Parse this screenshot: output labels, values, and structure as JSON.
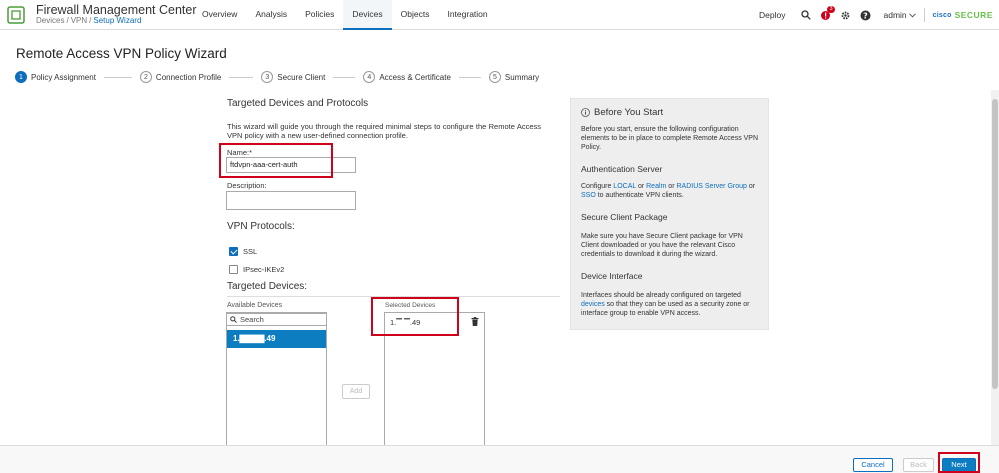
{
  "header": {
    "app_title": "Firewall Management Center",
    "breadcrumb": [
      "Devices",
      "VPN",
      "Setup Wizard"
    ],
    "nav_items": [
      {
        "label": "Overview"
      },
      {
        "label": "Analysis"
      },
      {
        "label": "Policies"
      },
      {
        "label": "Devices",
        "active": true
      },
      {
        "label": "Objects"
      },
      {
        "label": "Integration"
      }
    ],
    "deploy_label": "Deploy",
    "notification_count": "3",
    "user_label": "admin",
    "cisco_label": "cisco",
    "secure_label": "SECURE"
  },
  "page": {
    "title": "Remote Access VPN Policy Wizard"
  },
  "steps": [
    {
      "num": "1",
      "label": "Policy Assignment",
      "active": true
    },
    {
      "num": "2",
      "label": "Connection Profile"
    },
    {
      "num": "3",
      "label": "Secure Client"
    },
    {
      "num": "4",
      "label": "Access & Certificate"
    },
    {
      "num": "5",
      "label": "Summary"
    }
  ],
  "form": {
    "section_title": "Targeted Devices and Protocols",
    "intro": "This wizard will guide you through the required minimal steps to configure the Remote Access VPN policy with a new user-defined connection profile.",
    "name_label": "Name:*",
    "name_value": "ftdvpn-aaa-cert-auth",
    "description_label": "Description:",
    "description_value": "",
    "vpn_protocols_title": "VPN Protocols:",
    "protocols": [
      {
        "label": "SSL",
        "checked": true
      },
      {
        "label": "IPsec-IKEv2",
        "checked": false
      }
    ],
    "targeted_devices_title": "Targeted Devices:",
    "available_label": "Available Devices",
    "search_placeholder": "Search",
    "available_devices": [
      "1.▇▇▇▇.49"
    ],
    "add_label": "Add",
    "selected_label": "Selected Devices",
    "selected_devices": [
      "1.▔ ▔.49"
    ]
  },
  "info": {
    "title": "Before You Start",
    "intro": "Before you start, ensure the following configuration elements to be in place to complete Remote Access VPN Policy.",
    "auth_title": "Authentication Server",
    "auth_parts": [
      "Configure ",
      "LOCAL",
      " or ",
      "Realm",
      " or ",
      "RADIUS Server Group",
      " or ",
      "SSO",
      " to authenticate VPN clients."
    ],
    "client_title": "Secure Client Package",
    "client_text": "Make sure you have Secure Client package for VPN Client downloaded or you have the relevant Cisco credentials to download it during the wizard.",
    "iface_title": "Device Interface",
    "iface_parts": [
      "Interfaces should be already configured on targeted ",
      "devices",
      " so that they can be used as a security zone or interface group to enable VPN access."
    ]
  },
  "footer": {
    "cancel": "Cancel",
    "back": "Back",
    "next": "Next"
  },
  "colors": {
    "accent": "#0d6ebd",
    "highlight": "#d0021b"
  }
}
